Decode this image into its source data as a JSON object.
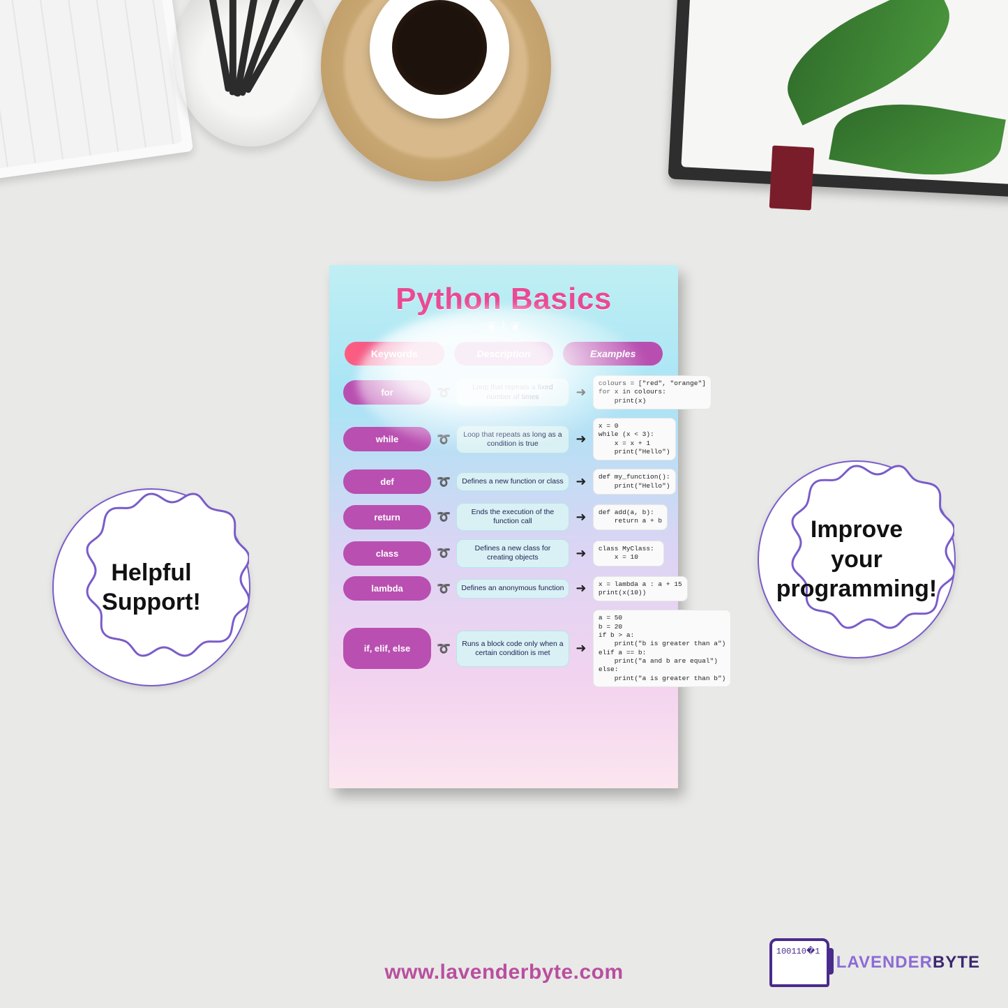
{
  "badges": {
    "left": "Helpful\nSupport!",
    "right": "Improve\nyour\nprogramming!"
  },
  "footer": {
    "url": "www.lavenderbyte.com",
    "brand_a": "LAVENDER",
    "brand_b": "BYTE"
  },
  "poster": {
    "title": "Python Basics",
    "headers": {
      "keywords": "Keywords",
      "description": "Description",
      "examples": "Examples"
    },
    "rows": [
      {
        "keyword": "for",
        "description": "Loop that repeats a fixed number of times",
        "example": "colours = [\"red\", \"orange\"]\nfor x in colours:\n    print(x)"
      },
      {
        "keyword": "while",
        "description": "Loop that repeats as long as a condition is true",
        "example": "x = 0\nwhile (x < 3):\n    x = x + 1\n    print(\"Hello\")"
      },
      {
        "keyword": "def",
        "description": "Defines a new function or class",
        "example": "def my_function():\n    print(\"Hello\")"
      },
      {
        "keyword": "return",
        "description": "Ends the execution of the function call",
        "example": "def add(a, b):\n    return a + b"
      },
      {
        "keyword": "class",
        "description": "Defines a new class for creating objects",
        "example": "class MyClass:\n    x = 10"
      },
      {
        "keyword": "lambda",
        "description": "Defines an anonymous function",
        "example": "x = lambda a : a + 15\nprint(x(10))"
      },
      {
        "keyword": "if, elif, else",
        "description": "Runs a block code only when a certain condition is met",
        "example": "a = 50\nb = 20\nif b > a:\n    print(\"b is greater than a\")\nelif a == b:\n    print(\"a and b are equal\")\nelse:\n    print(\"a is greater than b\")"
      }
    ]
  }
}
